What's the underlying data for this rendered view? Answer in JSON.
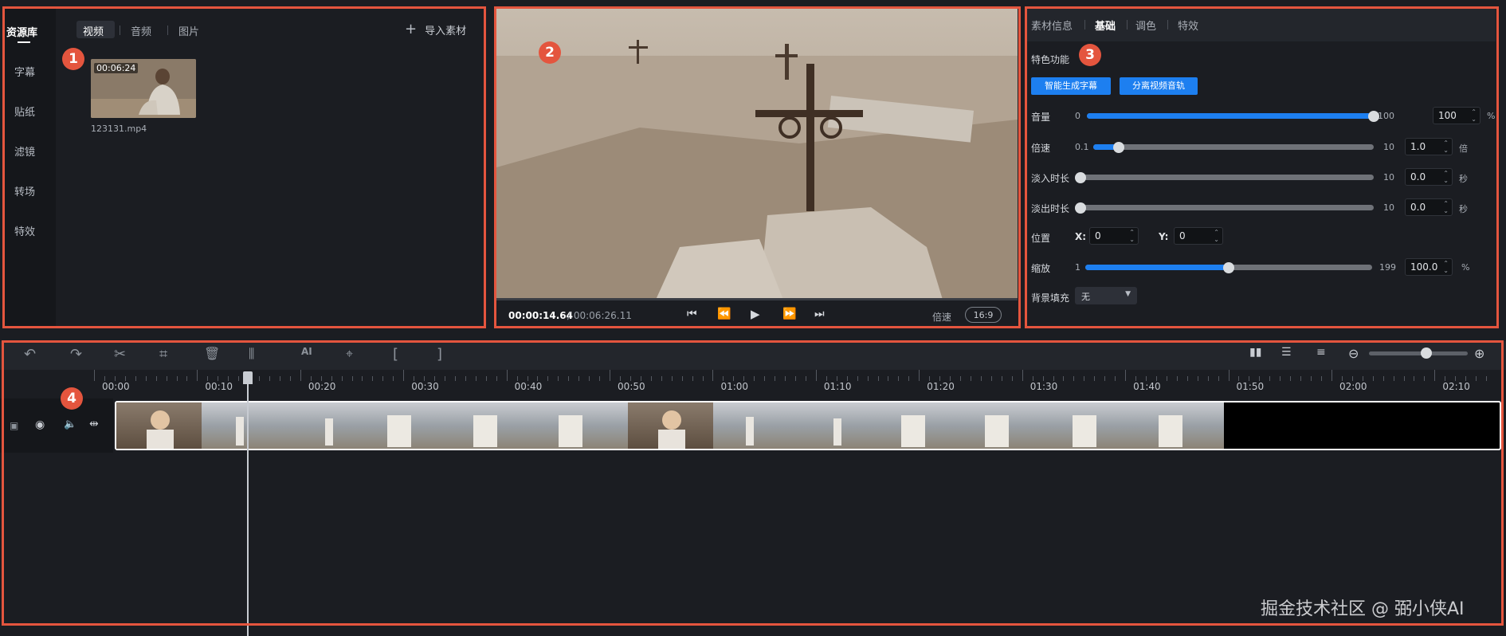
{
  "library": {
    "sidebar_title": "资源库",
    "sidebar_items": [
      "字幕",
      "贴纸",
      "滤镜",
      "转场",
      "特效"
    ],
    "tabs": [
      "视频",
      "音频",
      "图片"
    ],
    "import_label": "导入素材",
    "import_icon": "plus-icon",
    "media": {
      "duration": "00:06:24",
      "filename": "123131.mp4"
    }
  },
  "badges": [
    "1",
    "2",
    "3",
    "4"
  ],
  "preview": {
    "current_time": "00:00:14.64",
    "total_time": "/ 00:06:26.11",
    "speed_label": "倍速",
    "ratio": "16:9"
  },
  "props": {
    "tabs": [
      "素材信息",
      "基础",
      "调色",
      "特效"
    ],
    "active_tab": "基础",
    "feature_title": "特色功能",
    "btn_subtitle": "智能生成字幕",
    "btn_separate": "分离视频音轨",
    "volume": {
      "label": "音量",
      "min": "0",
      "max": "100",
      "value": "100",
      "unit": "%",
      "fraction": 1.0
    },
    "speed": {
      "label": "倍速",
      "min": "0.1",
      "max": "10",
      "value": "1.0",
      "unit": "倍",
      "fraction": 0.09
    },
    "fadein": {
      "label": "淡入时长",
      "min": "0",
      "max": "10",
      "value": "0.0",
      "unit": "秒",
      "fraction": 0.0
    },
    "fadeout": {
      "label": "淡出时长",
      "min": "0",
      "max": "10",
      "value": "0.0",
      "unit": "秒",
      "fraction": 0.0
    },
    "position": {
      "label": "位置",
      "x_label": "X:",
      "x_value": "0",
      "y_label": "Y:",
      "y_value": "0"
    },
    "scale": {
      "label": "缩放",
      "min": "1",
      "max": "199",
      "value": "100.0",
      "unit": "%",
      "fraction": 0.5
    },
    "bgfill": {
      "label": "背景填充",
      "value": "无"
    }
  },
  "timeline": {
    "ruler": [
      "00:00",
      "00:10",
      "00:20",
      "00:30",
      "00:40",
      "00:50",
      "01:00",
      "01:10",
      "01:20",
      "01:30",
      "01:40",
      "01:50",
      "02:00",
      "02:10"
    ],
    "ai_label": "AI",
    "zoom_fraction": 0.58
  },
  "watermark": "掘金技术社区 @ 弼小侠AI",
  "colors": {
    "accent": "#1d7ff0",
    "highlight": "#e4553e"
  }
}
